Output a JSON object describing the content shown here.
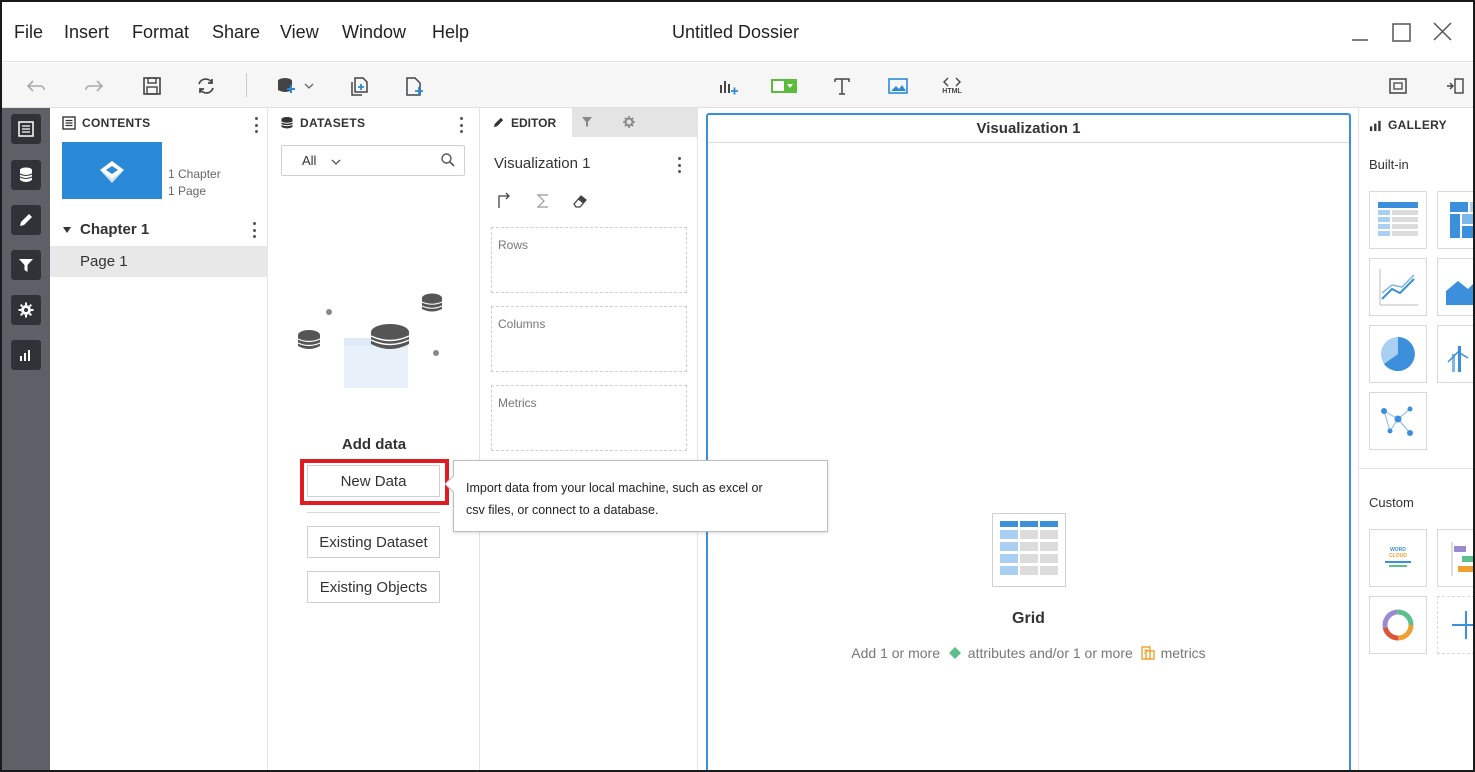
{
  "menubar": {
    "items": [
      "File",
      "Insert",
      "Format",
      "Share",
      "View",
      "Window",
      "Help"
    ],
    "title": "Untitled Dossier"
  },
  "toolbar": {
    "icons": [
      "undo-icon",
      "redo-icon",
      "save-icon",
      "refresh-icon",
      "add-dataset-icon",
      "duplicate-page-icon",
      "new-page-icon",
      "add-visualization-icon",
      "filter-element-icon",
      "text-icon",
      "image-icon",
      "html-container-icon",
      "fit-icon",
      "resize-icon"
    ],
    "html_label": "HTML"
  },
  "contents": {
    "title": "CONTENTS",
    "thumb_meta": [
      "1 Chapter",
      "1 Page"
    ],
    "chapter": "Chapter 1",
    "page": "Page 1"
  },
  "datasets": {
    "title": "DATASETS",
    "filter_value": "All",
    "add_data_label": "Add data",
    "new_data": "New Data",
    "existing_dataset": "Existing Dataset",
    "existing_objects": "Existing Objects"
  },
  "editor": {
    "tab_label": "EDITOR",
    "viz_name": "Visualization 1",
    "zones": [
      "Rows",
      "Columns",
      "Metrics"
    ]
  },
  "canvas": {
    "viz_title": "Visualization 1",
    "grid_title": "Grid",
    "hint_prefix": "Add 1 or more",
    "hint_attr": "attributes",
    "hint_mid": "and/or 1 or more",
    "hint_metric": "metrics"
  },
  "gallery": {
    "title": "GALLERY",
    "builtin": "Built-in",
    "custom": "Custom",
    "word_cloud_line1": "WORD",
    "word_cloud_line2": "CLOUD"
  },
  "tooltip": {
    "line1": "Import data from your local machine, such as excel or",
    "line2": "csv files, or connect to a database."
  },
  "colors": {
    "accent": "#3b8fdb",
    "highlight": "#e01b24",
    "rail": "#5d6066",
    "attribute": "#5cc08c",
    "metric": "#f0a030"
  }
}
